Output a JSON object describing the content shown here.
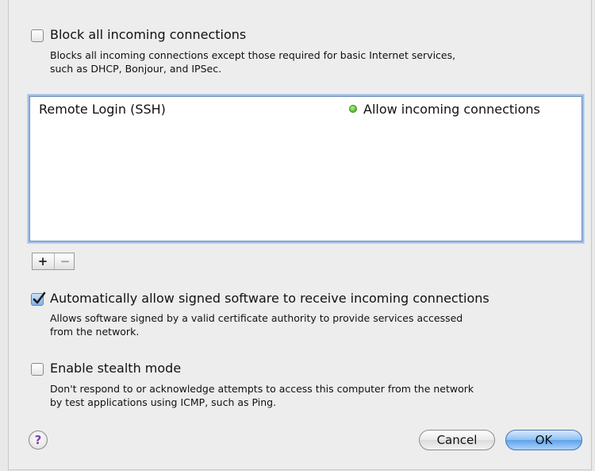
{
  "block_all": {
    "label": "Block all incoming connections",
    "checked": false,
    "description_line1": "Blocks all incoming connections except those required for basic Internet services,",
    "description_line2": "such as DHCP, Bonjour, and IPSec."
  },
  "apps_list": {
    "rows": [
      {
        "name": "Remote Login (SSH)",
        "status": "Allow incoming connections",
        "status_color": "#5fc23a"
      }
    ]
  },
  "list_controls": {
    "add_label": "+",
    "remove_label": "−"
  },
  "auto_allow_signed": {
    "label": "Automatically allow signed software to receive incoming connections",
    "checked": true,
    "description_line1": "Allows software signed by a valid certificate authority to provide services accessed",
    "description_line2": "from the network."
  },
  "stealth_mode": {
    "label": "Enable stealth mode",
    "checked": false,
    "description_line1": "Don't respond to or acknowledge attempts to access this computer from the network",
    "description_line2": "by test applications using ICMP, such as Ping."
  },
  "footer": {
    "help_label": "?",
    "cancel_label": "Cancel",
    "ok_label": "OK"
  }
}
